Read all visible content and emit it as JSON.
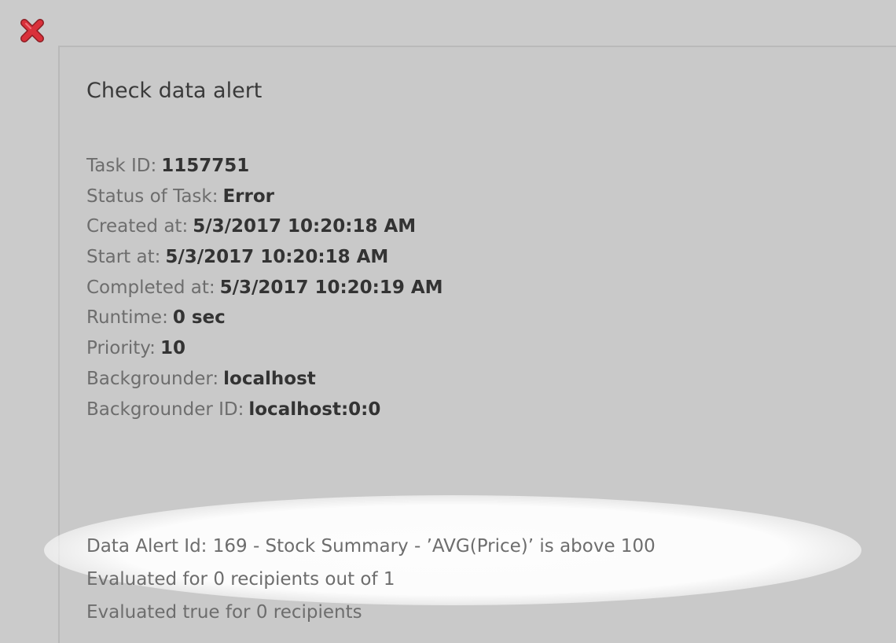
{
  "window": {
    "close_icon": "error-x-icon",
    "close_icon_color": "#d9303a"
  },
  "task": {
    "title": "Check data alert",
    "fields": [
      {
        "label": "Task ID:",
        "value": "1157751"
      },
      {
        "label": "Status of Task:",
        "value": "Error"
      },
      {
        "label": "Created at:",
        "value": "5/3/2017 10:20:18 AM"
      },
      {
        "label": "Start at:",
        "value": "5/3/2017 10:20:18 AM"
      },
      {
        "label": "Completed at:",
        "value": "5/3/2017 10:20:19 AM"
      },
      {
        "label": "Runtime:",
        "value": "0 sec"
      },
      {
        "label": "Priority:",
        "value": "10"
      },
      {
        "label": "Backgrounder:",
        "value": "localhost"
      },
      {
        "label": "Backgrounder ID:",
        "value": "localhost:0:0"
      }
    ]
  },
  "alert": {
    "lines": [
      "Data Alert Id: 169 - Stock Summary - ’AVG(Price)’ is above 100",
      "Evaluated for 0 recipients out of 1",
      "Evaluated true for 0 recipients"
    ]
  }
}
